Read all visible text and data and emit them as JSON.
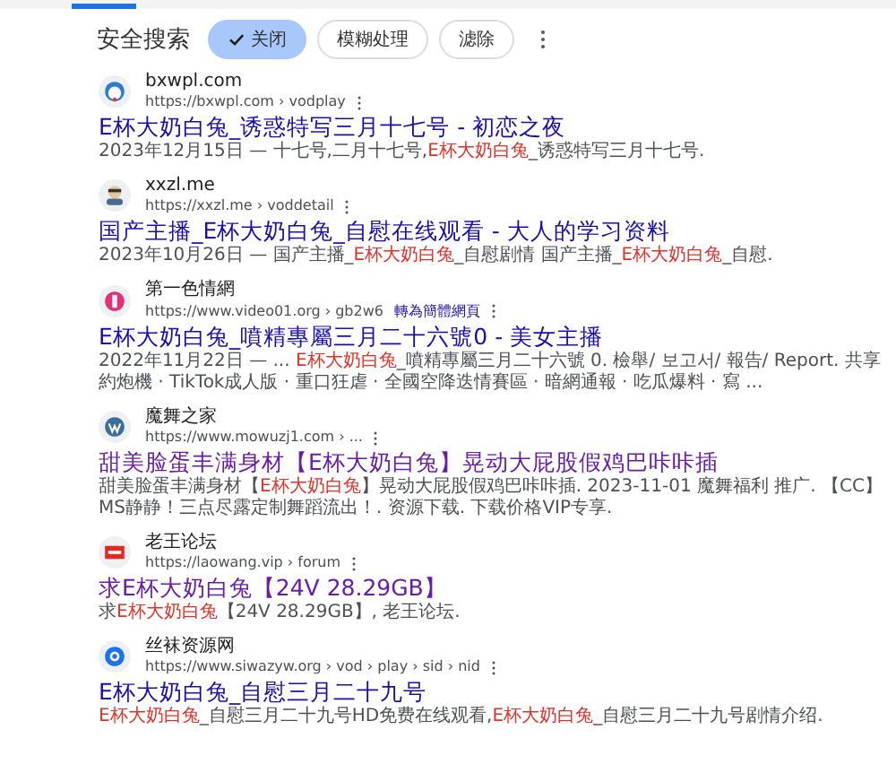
{
  "safe_search": {
    "label": "安全搜索",
    "chips": [
      {
        "label": "关闭",
        "selected": true
      },
      {
        "label": "模糊处理",
        "selected": false
      },
      {
        "label": "滤除",
        "selected": false
      }
    ]
  },
  "results": [
    {
      "site": "bxwpl.com",
      "url": "https://bxwpl.com › vodplay",
      "title": "E杯大奶白兔_诱惑特写三月十七号 - 初恋之夜",
      "visited": false,
      "snippet": [
        {
          "text": "2023年12月15日 — 十七号,二月十七号,",
          "highlight": false
        },
        {
          "text": "E杯大奶白兔",
          "highlight": true
        },
        {
          "text": "_诱惑特写三月十七号.",
          "highlight": false
        }
      ]
    },
    {
      "site": "xxzl.me",
      "url": "https://xxzl.me › voddetail",
      "title": "国产主播_E杯大奶白兔_自慰在线观看 - 大人的学习资料",
      "visited": false,
      "snippet": [
        {
          "text": "2023年10月26日 — 国产主播_",
          "highlight": false
        },
        {
          "text": "E杯大奶白兔",
          "highlight": true
        },
        {
          "text": "_自慰剧情 国产主播_",
          "highlight": false
        },
        {
          "text": "E杯大奶白兔",
          "highlight": true
        },
        {
          "text": "_自慰.",
          "highlight": false
        }
      ]
    },
    {
      "site": "第一色情網",
      "url": "https://www.video01.org › gb2w6",
      "translate": "轉為簡體網頁",
      "title": "E杯大奶白兔_噴精專屬三月二十六號0 - 美女主播",
      "visited": false,
      "snippet": [
        {
          "text": "2022年11月22日 — ... ",
          "highlight": false
        },
        {
          "text": "E杯大奶白兔",
          "highlight": true
        },
        {
          "text": "_噴精專屬三月二十六號 0. 檢舉/ 보고서/ 報告/ Report. 共享約炮機 · TikTok成人版 · 重口狂虐 · 全國空降迭情賽區 · 暗網通報 · 吃瓜爆料 · 寫 ...",
          "highlight": false
        }
      ]
    },
    {
      "site": "魔舞之家",
      "url": "https://www.mowuzj1.com › ...",
      "title": "甜美脸蛋丰满身材【E杯大奶白兔】晃动大屁股假鸡巴咔咔插",
      "visited": true,
      "snippet": [
        {
          "text": "甜美脸蛋丰满身材【",
          "highlight": false
        },
        {
          "text": "E杯大奶白兔",
          "highlight": true
        },
        {
          "text": "】晃动大屁股假鸡巴咔咔插. 2023-11-01 魔舞福利 推广. 【CC】MS静静！三点尽露定制舞蹈流出！. 资源下载. 下载价格VIP专享.",
          "highlight": false
        }
      ]
    },
    {
      "site": "老王论坛",
      "url": "https://laowang.vip › forum",
      "title": "求E杯大奶白兔【24V 28.29GB】",
      "visited": true,
      "snippet": [
        {
          "text": "求",
          "highlight": false
        },
        {
          "text": "E杯大奶白兔",
          "highlight": true
        },
        {
          "text": "【24V 28.29GB】, 老王论坛.",
          "highlight": false
        }
      ]
    },
    {
      "site": "丝袜资源网",
      "url": "https://www.siwazyw.org › vod › play › sid › nid",
      "title": "E杯大奶白兔_自慰三月二十九号",
      "visited": false,
      "snippet": [
        {
          "text": "E杯大奶白兔",
          "highlight": true
        },
        {
          "text": "_自慰三月二十九号HD免费在线观看,",
          "highlight": false
        },
        {
          "text": "E杯大奶白兔",
          "highlight": true
        },
        {
          "text": "_自慰三月二十九号剧情介绍.",
          "highlight": false
        }
      ]
    }
  ]
}
